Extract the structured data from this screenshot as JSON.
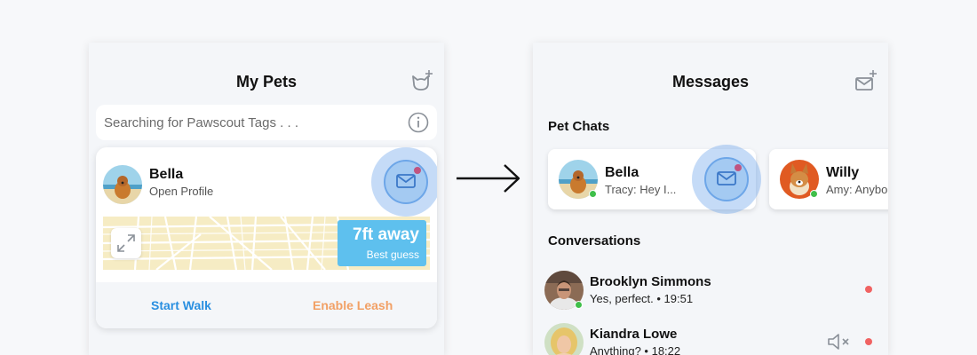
{
  "left_screen": {
    "title": "My Pets",
    "search_placeholder": "Searching for Pawscout Tags . . .",
    "pet": {
      "name": "Bella",
      "subtitle": "Open Profile"
    },
    "distance": {
      "value": "7ft away",
      "caption": "Best guess"
    },
    "actions": {
      "start_walk": "Start Walk",
      "enable_leash": "Enable Leash"
    }
  },
  "right_screen": {
    "title": "Messages",
    "pet_chats_heading": "Pet Chats",
    "pet_chats": [
      {
        "name": "Bella",
        "preview": "Tracy: Hey I..."
      },
      {
        "name": "Willy",
        "preview": "Amy: Anybo"
      }
    ],
    "conversations_heading": "Conversations",
    "conversations": [
      {
        "name": "Brooklyn Simmons",
        "preview": "Yes, perfect. • 19:51",
        "unread": true,
        "muted": false,
        "online": true
      },
      {
        "name": "Kiandra Lowe",
        "preview": "Anything? • 18:22",
        "unread": true,
        "muted": true,
        "online": false
      }
    ]
  },
  "colors": {
    "primary_blue": "#2a8fe0",
    "leash_orange": "#f2a065",
    "distance_badge": "#5ec0ee",
    "map_bg": "#f6ecc4",
    "notification_dot": "#c05480",
    "unread_dot": "#f06262",
    "online_green": "#3fbf4a"
  }
}
